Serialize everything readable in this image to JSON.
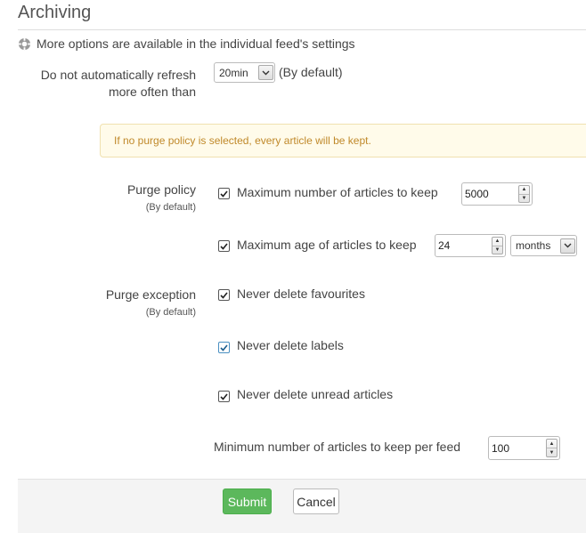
{
  "section": {
    "title": "Archiving",
    "hint": "More options are available in the individual feed's settings",
    "hint_icon": "gear-icon"
  },
  "refresh": {
    "label": "Do not automatically refresh more often than",
    "value": "20min",
    "suffix": "(By default)"
  },
  "alert": {
    "text": "If no purge policy is selected, every article will be kept."
  },
  "purge_policy": {
    "label": "Purge policy",
    "sub": "(By default)",
    "max_articles_label": "Maximum number of articles to keep",
    "max_articles_checked": true,
    "max_articles_value": "5000",
    "max_age_label": "Maximum age of articles to keep",
    "max_age_checked": true,
    "max_age_value": "24",
    "max_age_unit": "months"
  },
  "purge_exception": {
    "label": "Purge exception",
    "sub": "(By default)",
    "favourites_label": "Never delete favourites",
    "favourites_checked": true,
    "labels_label": "Never delete labels",
    "labels_checked": true,
    "unread_label": "Never delete unread articles",
    "unread_checked": true,
    "min_per_feed_label": "Minimum number of articles to keep per feed",
    "min_per_feed_value": "100"
  },
  "actions": {
    "submit": "Submit",
    "cancel": "Cancel"
  },
  "colors": {
    "submit_bg": "#5cb85c",
    "alert_bg": "#fffbea",
    "alert_text": "#c0892a"
  }
}
